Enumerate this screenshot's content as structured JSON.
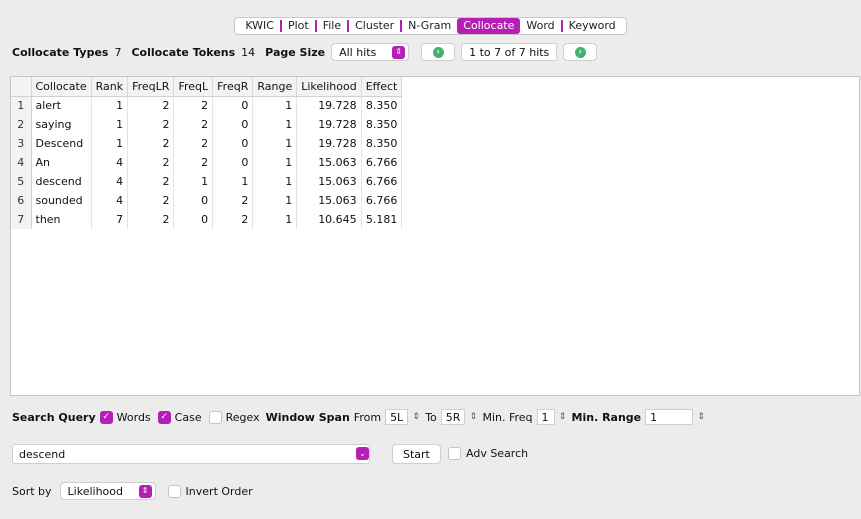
{
  "tabs": [
    {
      "label": "KWIC",
      "active": false
    },
    {
      "label": "Plot",
      "active": false
    },
    {
      "label": "File",
      "active": false
    },
    {
      "label": "Cluster",
      "active": false
    },
    {
      "label": "N-Gram",
      "active": false
    },
    {
      "label": "Collocate",
      "active": true
    },
    {
      "label": "Word",
      "active": false
    },
    {
      "label": "Keyword",
      "active": false
    }
  ],
  "topbar": {
    "collocate_types_label": "Collocate Types",
    "collocate_types_value": "7",
    "collocate_tokens_label": "Collocate Tokens",
    "collocate_tokens_value": "14",
    "page_size_label": "Page Size",
    "page_size_value": "All hits",
    "hits_text": "1 to 7 of 7 hits"
  },
  "table": {
    "columns": [
      "Collocate",
      "Rank",
      "FreqLR",
      "FreqL",
      "FreqR",
      "Range",
      "Likelihood",
      "Effect"
    ],
    "rows": [
      [
        "1",
        "alert",
        "1",
        "2",
        "2",
        "0",
        "1",
        "19.728",
        "8.350"
      ],
      [
        "2",
        "saying",
        "1",
        "2",
        "2",
        "0",
        "1",
        "19.728",
        "8.350"
      ],
      [
        "3",
        "Descend",
        "1",
        "2",
        "2",
        "0",
        "1",
        "19.728",
        "8.350"
      ],
      [
        "4",
        "An",
        "4",
        "2",
        "2",
        "0",
        "1",
        "15.063",
        "6.766"
      ],
      [
        "5",
        "descend",
        "4",
        "2",
        "1",
        "1",
        "1",
        "15.063",
        "6.766"
      ],
      [
        "6",
        "sounded",
        "4",
        "2",
        "0",
        "2",
        "1",
        "15.063",
        "6.766"
      ],
      [
        "7",
        "then",
        "7",
        "2",
        "0",
        "2",
        "1",
        "10.645",
        "5.181"
      ]
    ]
  },
  "search": {
    "query_label": "Search Query",
    "words_label": "Words",
    "words_checked": true,
    "case_label": "Case",
    "case_checked": true,
    "regex_label": "Regex",
    "regex_checked": false,
    "window_span_label": "Window Span",
    "from_label": "From",
    "from_value": "5L",
    "to_label": "To",
    "to_value": "5R",
    "min_freq_label": "Min. Freq",
    "min_freq_value": "1",
    "min_range_label": "Min. Range",
    "min_range_value": "1",
    "query_value": "descend",
    "start_label": "Start",
    "adv_search_label": "Adv Search"
  },
  "sort": {
    "sort_by_label": "Sort by",
    "sort_by_value": "Likelihood",
    "invert_order_label": "Invert Order"
  },
  "colors": {
    "accent": "#b51fb5",
    "nav_green": "#3fb56a"
  }
}
